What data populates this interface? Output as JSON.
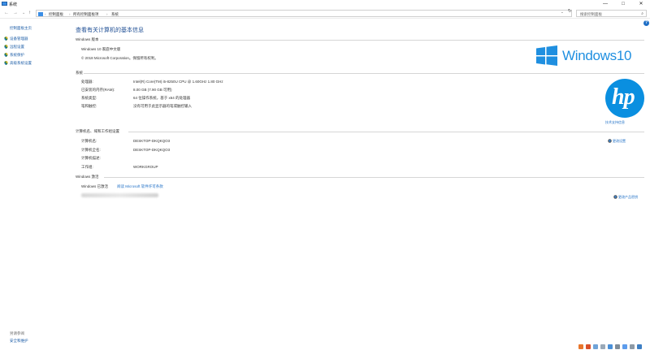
{
  "window": {
    "title": "系统",
    "minimize": "—",
    "maximize": "□",
    "close": "✕"
  },
  "address": {
    "crumbs": [
      "控制面板",
      "所有控制面板项",
      "系统"
    ],
    "separator": "›",
    "search_placeholder": "搜索控制面板"
  },
  "sidebar": {
    "home": "控制面板主页",
    "items": [
      {
        "label": "设备管理器"
      },
      {
        "label": "远程设置"
      },
      {
        "label": "系统保护"
      },
      {
        "label": "高级系统设置"
      }
    ],
    "see_also": "另请参阅",
    "security": "安全和维护"
  },
  "main": {
    "title": "查看有关计算机的基本信息",
    "edition": {
      "heading": "Windows 版本",
      "name": "Windows 10 家庭中文版",
      "copyright": "© 2018 Microsoft Corporation。保留所有权利。"
    },
    "brand_logo_text": "Windows10",
    "system": {
      "heading": "系统",
      "rows": [
        {
          "label": "处理器:",
          "value": "Intel(R) Core(TM) i5-8250U CPU @ 1.60GHz   1.80 GHz"
        },
        {
          "label": "已安装的内存(RAM):",
          "value": "8.00 GB (7.90 GB 可用)"
        },
        {
          "label": "系统类型:",
          "value": "64 位操作系统，基于 x64 的处理器"
        },
        {
          "label": "笔和触控:",
          "value": "没有可用于此显示器的笔或触控输入"
        }
      ],
      "oem_logo": "hp",
      "oem_support": "技术支持信息"
    },
    "computer": {
      "heading": "计算机名、域和工作组设置",
      "rows": [
        {
          "label": "计算机名:",
          "value": "DESKTOP-DKQKQO3"
        },
        {
          "label": "计算机全名:",
          "value": "DESKTOP-DKQKQO3"
        },
        {
          "label": "计算机描述:",
          "value": ""
        },
        {
          "label": "工作组:",
          "value": "WORKGROUP"
        }
      ],
      "change_settings": "更改设置"
    },
    "activation": {
      "heading": "Windows 激活",
      "status": "Windows 已激活",
      "link": "阅读 Microsoft 软件许可条款",
      "change_key": "更改产品密钥"
    }
  },
  "colors": {
    "link": "#1f6fc6",
    "title": "#1e4e94",
    "windows_blue": "#1f8fe0",
    "hp_blue": "#0a8fe0"
  }
}
